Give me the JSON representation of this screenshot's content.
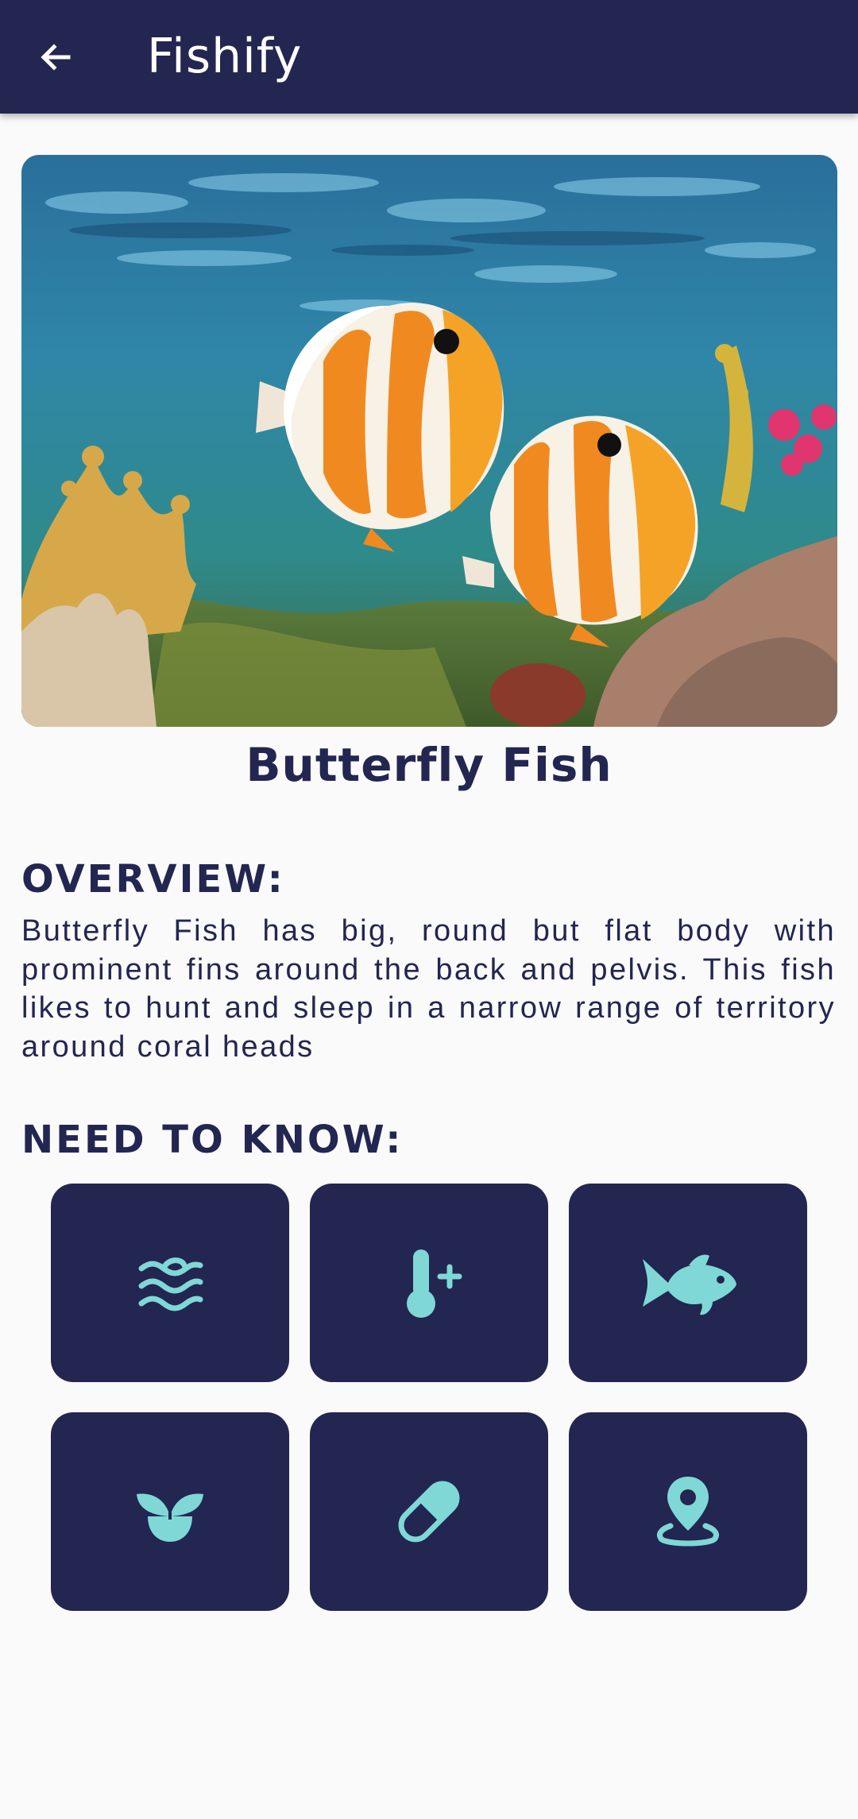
{
  "appbar": {
    "title": "Fishify",
    "back_icon": "arrow-left-icon"
  },
  "fish": {
    "name": "Butterfly Fish",
    "image": "butterfly-fish-photo"
  },
  "overview": {
    "heading": "OVERVIEW:",
    "text": "Butterfly Fish has big, round but flat body with prominent fins around the back and pelvis. This fish likes to hunt and sleep in a narrow range of territory around coral heads"
  },
  "need_to_know": {
    "heading": "NEED TO KNOW:",
    "tiles": [
      {
        "icon": "water-waves-icon"
      },
      {
        "icon": "thermometer-plus-icon"
      },
      {
        "icon": "fish-icon"
      },
      {
        "icon": "plant-sprout-icon"
      },
      {
        "icon": "pill-capsule-icon"
      },
      {
        "icon": "location-pin-icon"
      }
    ]
  },
  "colors": {
    "primary": "#232650",
    "accent_icon": "#7fd8d6",
    "background": "#fafafa",
    "appbar_text": "#ffffff"
  }
}
